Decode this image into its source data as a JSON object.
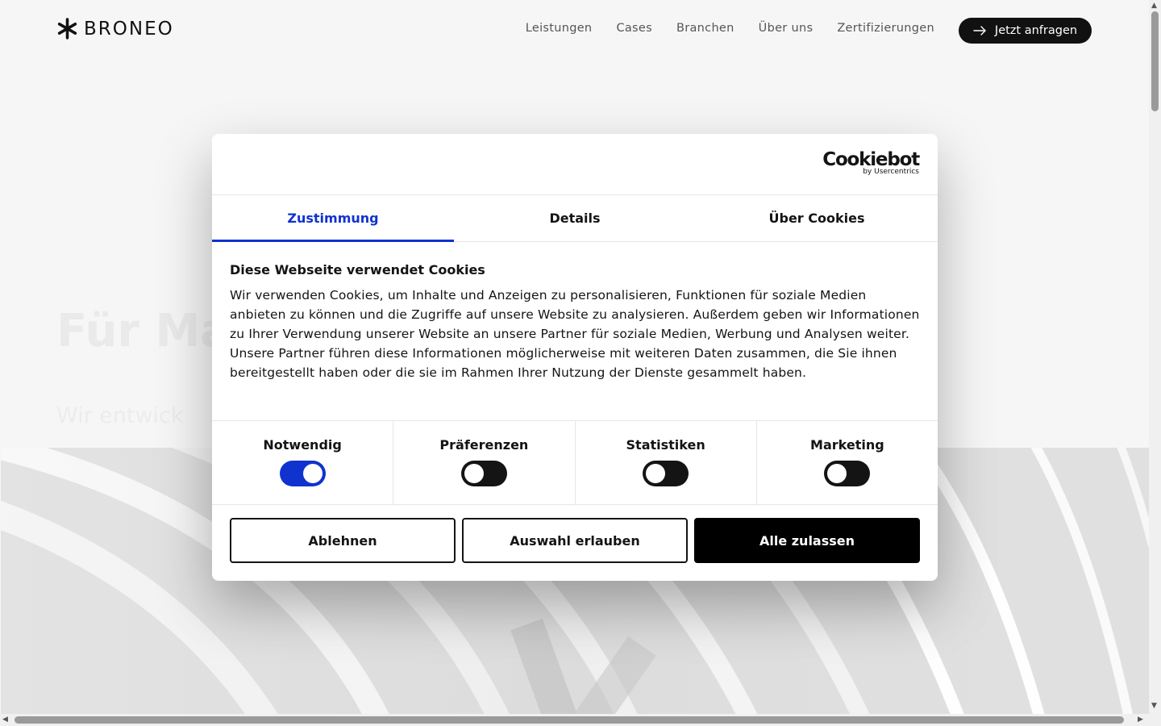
{
  "header": {
    "logo_text": "BRONEO",
    "nav": [
      "Leistungen",
      "Cases",
      "Branchen",
      "Über uns",
      "Zertifizierungen"
    ],
    "cta_label": "Jetzt anfragen"
  },
  "hero": {
    "title": "Für Ma",
    "subtitle": "Wir entwick"
  },
  "dialog": {
    "brand": "Cookiebot",
    "brand_sub": "by Usercentrics",
    "tabs": [
      "Zustimmung",
      "Details",
      "Über Cookies"
    ],
    "active_tab": "Zustimmung",
    "title": "Diese Webseite verwendet Cookies",
    "text": "Wir verwenden Cookies, um Inhalte und Anzeigen zu personalisieren, Funktionen für soziale Medien anbieten zu können und die Zugriffe auf unsere Website zu analysieren. Außerdem geben wir Informationen zu Ihrer Verwendung unserer Website an unsere Partner für soziale Medien, Werbung und Analysen weiter. Unsere Partner führen diese Informationen möglicherweise mit weiteren Daten zusammen, die Sie ihnen bereitgestellt haben oder die sie im Rahmen Ihrer Nutzung der Dienste gesammelt haben.",
    "categories": [
      {
        "label": "Notwendig",
        "enabled": true
      },
      {
        "label": "Präferenzen",
        "enabled": false
      },
      {
        "label": "Statistiken",
        "enabled": false
      },
      {
        "label": "Marketing",
        "enabled": false
      }
    ],
    "buttons": {
      "decline": "Ablehnen",
      "allow_selection": "Auswahl erlauben",
      "allow_all": "Alle zulassen"
    },
    "accent_color": "#1032cf"
  }
}
